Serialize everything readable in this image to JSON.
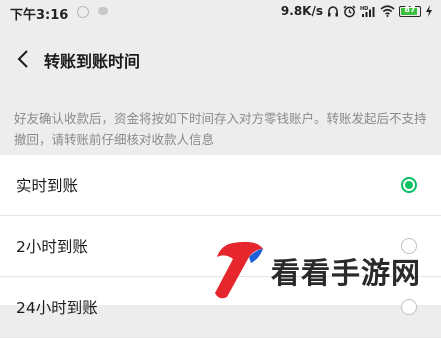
{
  "status_bar": {
    "time": "下午3:16",
    "network_speed": "9.8K/s",
    "battery_level": "87",
    "icons": [
      "weibo-icon",
      "wechat-icon",
      "headphone-icon",
      "alarm-icon",
      "hd-signal-icon",
      "wifi-icon",
      "battery-icon",
      "charging-icon"
    ]
  },
  "header": {
    "title": "转账到账时间",
    "back_icon": "chevron-left-icon"
  },
  "description": "好友确认收款后，资金将按如下时间存入对方零钱账户。转账发起后不支持撤回，请转账前仔细核对收款人信息",
  "options": [
    {
      "label": "实时到账",
      "selected": true
    },
    {
      "label": "2小时到账",
      "selected": false
    },
    {
      "label": "24小时到账",
      "selected": false
    }
  ],
  "watermark": {
    "text": "看看手游网"
  },
  "colors": {
    "accent": "#07c160",
    "background": "#ededed",
    "text_secondary": "#8a8a8a"
  }
}
